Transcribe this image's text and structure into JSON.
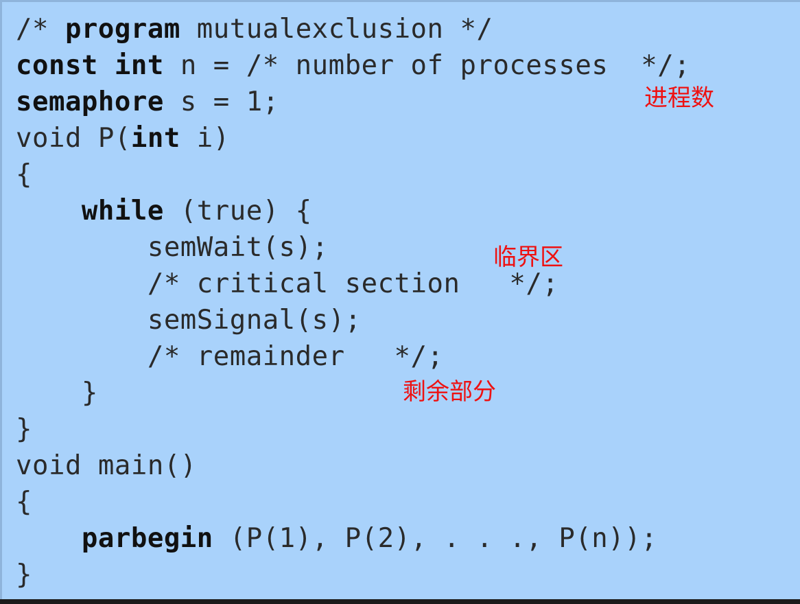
{
  "code": {
    "line1": {
      "a": "/* ",
      "b": "program",
      "c": " mutualexclusion */"
    },
    "line2": {
      "a": "const",
      "b": " ",
      "c": "int",
      "d": " n = /* number of processes  */;"
    },
    "line3": {
      "a": "semaphore",
      "b": " s = 1;"
    },
    "line4": {
      "a": "void P(",
      "b": "int",
      "c": " i)"
    },
    "line5": "{",
    "line6": {
      "indent": "    ",
      "a": "while",
      "b": " (true) {"
    },
    "line7": "        semWait(s);",
    "line8": "        /* critical section   */;",
    "line9": "        semSignal(s);",
    "line10": "        /* remainder   */;",
    "line11": "    }",
    "line12": "}",
    "line13": "void main()",
    "line14": "{",
    "line15": {
      "indent": "    ",
      "a": "parbegin",
      "b": " (P(1), P(2), . . ., P(n));"
    },
    "line16": "}"
  },
  "annotations": {
    "process_count": "进程数",
    "critical_section": "临界区",
    "remainder": "剩余部分"
  },
  "colors": {
    "background": "#a9d2fb",
    "annotation": "#ee1111",
    "text": "#1a1a1a"
  }
}
